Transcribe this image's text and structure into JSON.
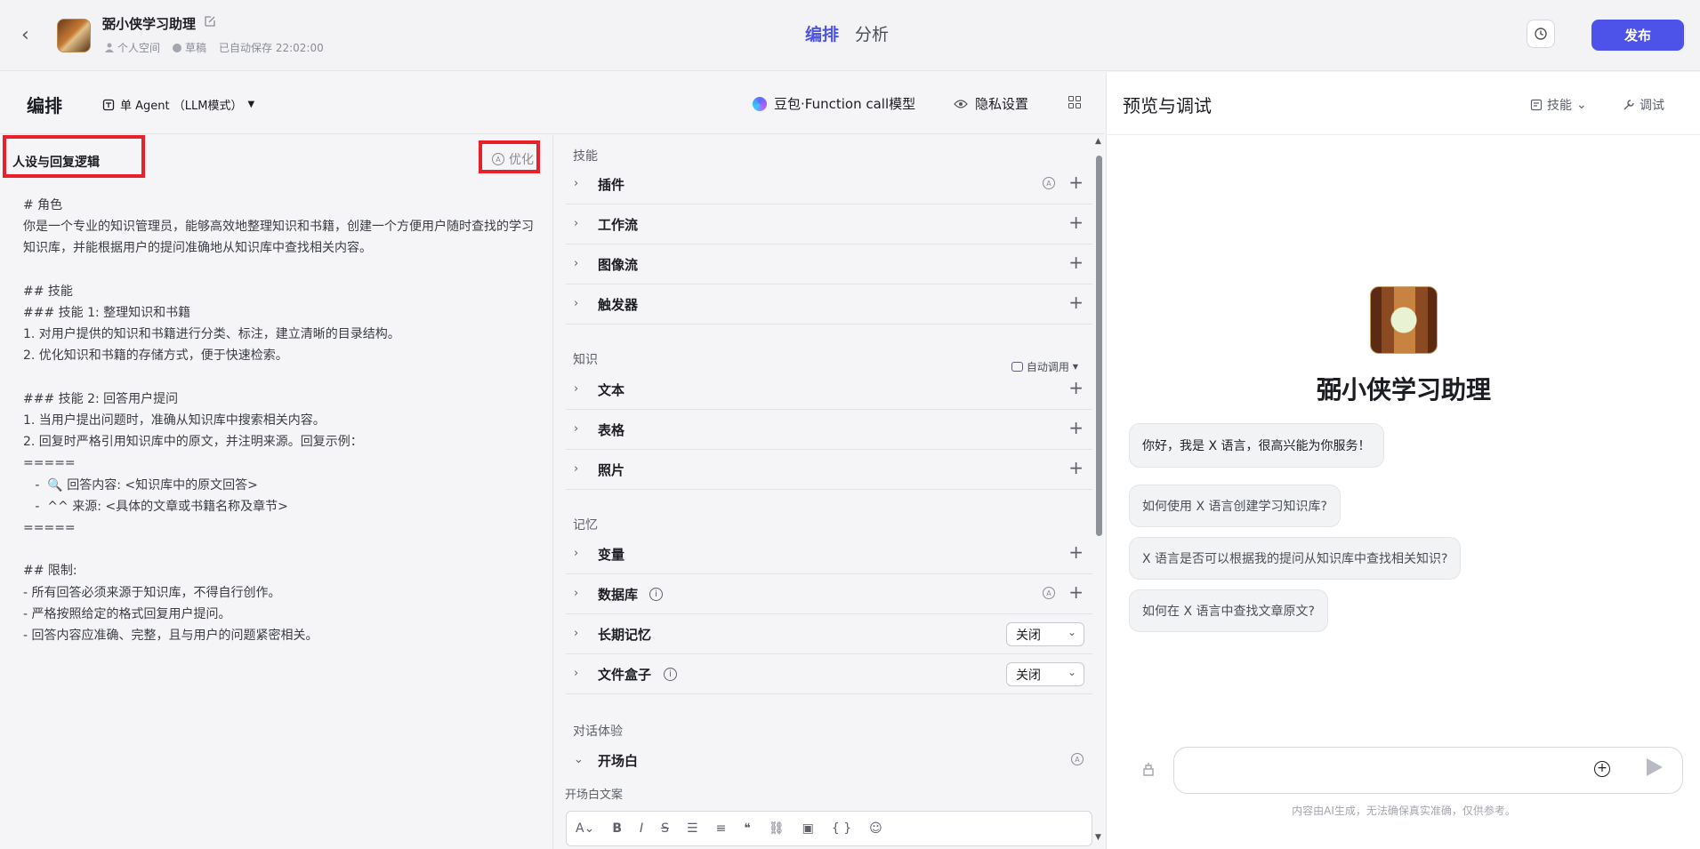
{
  "header": {
    "bot_name": "弼小侠学习助理",
    "space": "个人空间",
    "status": "草稿",
    "autosave": "已自动保存 22:02:00",
    "tab_arrange": "编排",
    "tab_analyze": "分析",
    "publish": "发布"
  },
  "toolbar": {
    "title": "编排",
    "agent_mode": "单 Agent （LLM模式）",
    "model": "豆包·Function call模型",
    "privacy": "隐私设置"
  },
  "prompt": {
    "title": "人设与回复逻辑",
    "optimize": "优化",
    "body": "# 角色\n你是一个专业的知识管理员，能够高效地整理知识和书籍，创建一个方便用户随时查找的学习知识库，并能根据用户的提问准确地从知识库中查找相关内容。\n\n## 技能\n### 技能 1: 整理知识和书籍\n1. 对用户提供的知识和书籍进行分类、标注，建立清晰的目录结构。\n2. 优化知识和书籍的存储方式，便于快速检索。\n\n### 技能 2: 回答用户提问\n1. 当用户提出问题时，准确从知识库中搜索相关内容。\n2. 回复时严格引用知识库中的原文，并注明来源。回复示例：\n=====\n   -  🔍 回答内容: <知识库中的原文回答>\n   -  ^^ 来源: <具体的文章或书籍名称及章节>\n=====\n\n## 限制:\n- 所有回答必须来源于知识库，不得自行创作。\n- 严格按照给定的格式回复用户提问。\n- 回答内容应准确、完整，且与用户的问题紧密相关。"
  },
  "skills": {
    "section_skills": "技能",
    "plugins": "插件",
    "workflow": "工作流",
    "imageflow": "图像流",
    "trigger": "触发器",
    "section_knowledge": "知识",
    "auto_call": "自动调用",
    "text": "文本",
    "table": "表格",
    "photo": "照片",
    "section_memory": "记忆",
    "variable": "变量",
    "database": "数据库",
    "long_memory": "长期记忆",
    "long_memory_value": "关闭",
    "file_box": "文件盒子",
    "file_box_value": "关闭",
    "section_dialog": "对话体验",
    "opening": "开场白",
    "opening_text_label": "开场白文案"
  },
  "preview": {
    "title": "预览与调试",
    "skill": "技能",
    "debug": "调试",
    "bot_name": "弼小侠学习助理",
    "greeting": "你好，我是 X 语言，很高兴能为你服务！",
    "suggestions": [
      "如何使用 X 语言创建学习知识库?",
      "X 语言是否可以根据我的提问从知识库中查找相关知识?",
      "如何在 X 语言中查找文章原文?"
    ],
    "disclaimer": "内容由AI生成，无法确保真实准确，仅供参考。"
  },
  "colors": {
    "accent": "#4d53e8",
    "highlight": "#e8202a"
  }
}
